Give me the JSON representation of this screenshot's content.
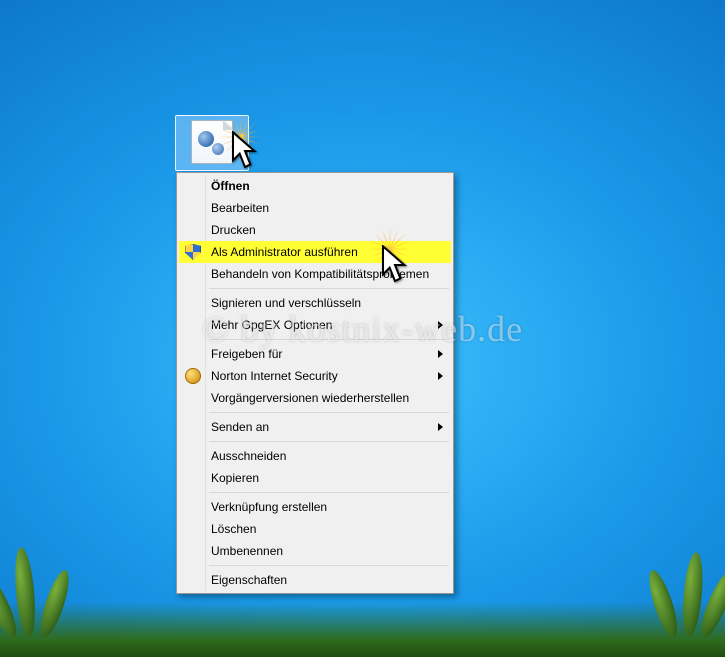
{
  "menu": {
    "open": "Öffnen",
    "edit": "Bearbeiten",
    "print": "Drucken",
    "runas": "Als Administrator ausführen",
    "compat": "Behandeln von Kompatibilitätsproblemen",
    "sign": "Signieren und verschlüsseln",
    "gpg": "Mehr GpgEX Optionen",
    "share": "Freigeben für",
    "norton": "Norton Internet Security",
    "prev": "Vorgängerversionen wiederherstellen",
    "sendto": "Senden an",
    "cut": "Ausschneiden",
    "copy": "Kopieren",
    "link": "Verknüpfung erstellen",
    "delete": "Löschen",
    "rename": "Umbenennen",
    "props": "Eigenschaften"
  },
  "watermark": "© by kostnix-web.de"
}
